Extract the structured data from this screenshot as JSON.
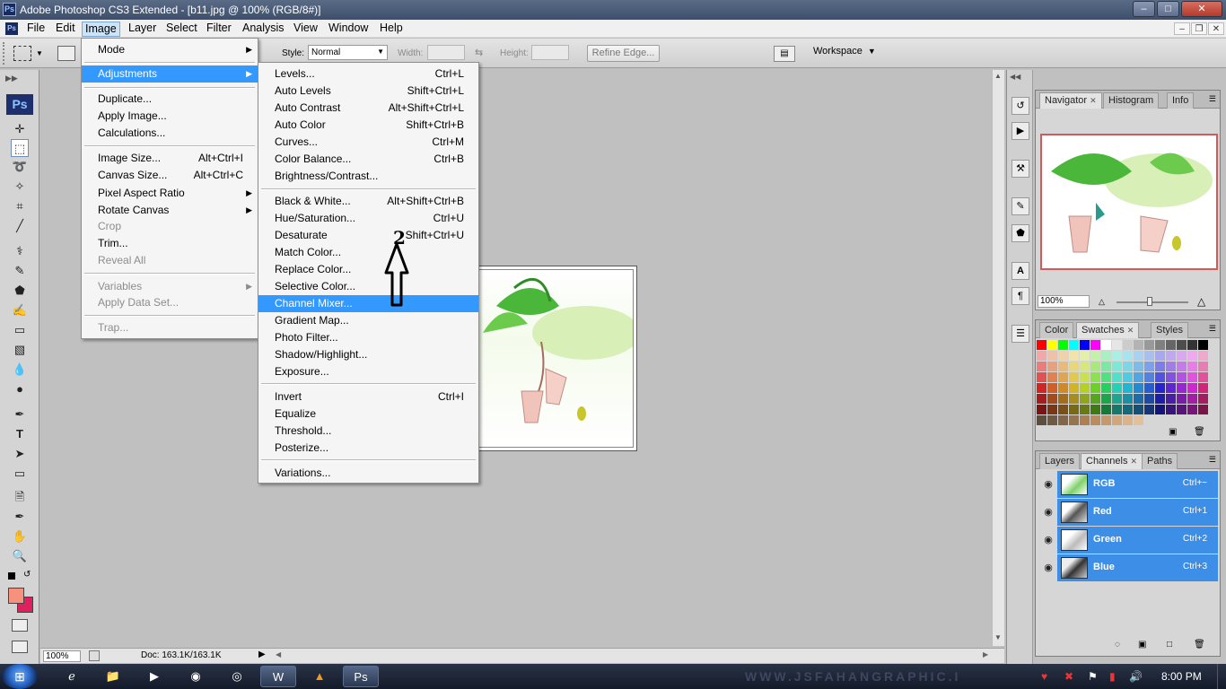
{
  "window": {
    "title": "Adobe Photoshop CS3 Extended - [b11.jpg @ 100% (RGB/8#)]",
    "app_badge": "Ps",
    "controls": [
      "minimize",
      "maximize",
      "close"
    ]
  },
  "menubar": {
    "items": [
      "File",
      "Edit",
      "Image",
      "Layer",
      "Select",
      "Filter",
      "Analysis",
      "View",
      "Window",
      "Help"
    ],
    "active": "Image"
  },
  "options_bar": {
    "style_label": "Style:",
    "style_value": "Normal",
    "width_label": "Width:",
    "height_label": "Height:",
    "refine_edge": "Refine Edge...",
    "workspace": "Workspace"
  },
  "toolbox": {
    "logo": "Ps",
    "foreground_color": "#f6917e",
    "background_color": "#e0205e"
  },
  "image_menu": {
    "items": [
      {
        "label": "Mode",
        "submenu": true
      },
      {
        "label": "Adjustments",
        "submenu": true,
        "highlighted": true
      },
      {
        "label": "Duplicate..."
      },
      {
        "label": "Apply Image..."
      },
      {
        "label": "Calculations..."
      },
      {
        "label": "Image Size...",
        "shortcut": "Alt+Ctrl+I"
      },
      {
        "label": "Canvas Size...",
        "shortcut": "Alt+Ctrl+C"
      },
      {
        "label": "Pixel Aspect Ratio",
        "submenu": true
      },
      {
        "label": "Rotate Canvas",
        "submenu": true
      },
      {
        "label": "Crop",
        "disabled": true
      },
      {
        "label": "Trim..."
      },
      {
        "label": "Reveal All",
        "disabled": true
      },
      {
        "label": "Variables",
        "submenu": true,
        "disabled": true
      },
      {
        "label": "Apply Data Set...",
        "disabled": true
      },
      {
        "label": "Trap...",
        "disabled": true
      }
    ]
  },
  "adjustments_menu": {
    "items": [
      {
        "label": "Levels...",
        "shortcut": "Ctrl+L"
      },
      {
        "label": "Auto Levels",
        "shortcut": "Shift+Ctrl+L"
      },
      {
        "label": "Auto Contrast",
        "shortcut": "Alt+Shift+Ctrl+L"
      },
      {
        "label": "Auto Color",
        "shortcut": "Shift+Ctrl+B"
      },
      {
        "label": "Curves...",
        "shortcut": "Ctrl+M"
      },
      {
        "label": "Color Balance...",
        "shortcut": "Ctrl+B"
      },
      {
        "label": "Brightness/Contrast..."
      },
      {
        "label": "Black & White...",
        "shortcut": "Alt+Shift+Ctrl+B"
      },
      {
        "label": "Hue/Saturation...",
        "shortcut": "Ctrl+U"
      },
      {
        "label": "Desaturate",
        "shortcut": "Shift+Ctrl+U"
      },
      {
        "label": "Match Color..."
      },
      {
        "label": "Replace Color..."
      },
      {
        "label": "Selective Color..."
      },
      {
        "label": "Channel Mixer...",
        "highlighted": true
      },
      {
        "label": "Gradient Map..."
      },
      {
        "label": "Photo Filter..."
      },
      {
        "label": "Shadow/Highlight..."
      },
      {
        "label": "Exposure..."
      },
      {
        "label": "Invert",
        "shortcut": "Ctrl+I"
      },
      {
        "label": "Equalize"
      },
      {
        "label": "Threshold..."
      },
      {
        "label": "Posterize..."
      },
      {
        "label": "Variations..."
      }
    ]
  },
  "annotation": {
    "number": "2"
  },
  "statusbar": {
    "zoom": "100%",
    "doc": "Doc: 163.1K/163.1K"
  },
  "navigator_panel": {
    "tabs": [
      "Navigator",
      "Histogram",
      "Info"
    ],
    "active_tab": "Navigator",
    "zoom": "100%"
  },
  "swatches_panel": {
    "tabs": [
      "Color",
      "Swatches",
      "Styles"
    ],
    "active_tab": "Swatches"
  },
  "channels_panel": {
    "tabs": [
      "Layers",
      "Channels",
      "Paths"
    ],
    "active_tab": "Channels",
    "channels": [
      {
        "name": "RGB",
        "shortcut": "Ctrl+~"
      },
      {
        "name": "Red",
        "shortcut": "Ctrl+1"
      },
      {
        "name": "Green",
        "shortcut": "Ctrl+2"
      },
      {
        "name": "Blue",
        "shortcut": "Ctrl+3"
      }
    ],
    "selection_color": "#3d8ee6"
  },
  "taskbar": {
    "clock": "8:00 PM",
    "watermark": "WWW.JSFAHANGRAPHIC.I"
  }
}
